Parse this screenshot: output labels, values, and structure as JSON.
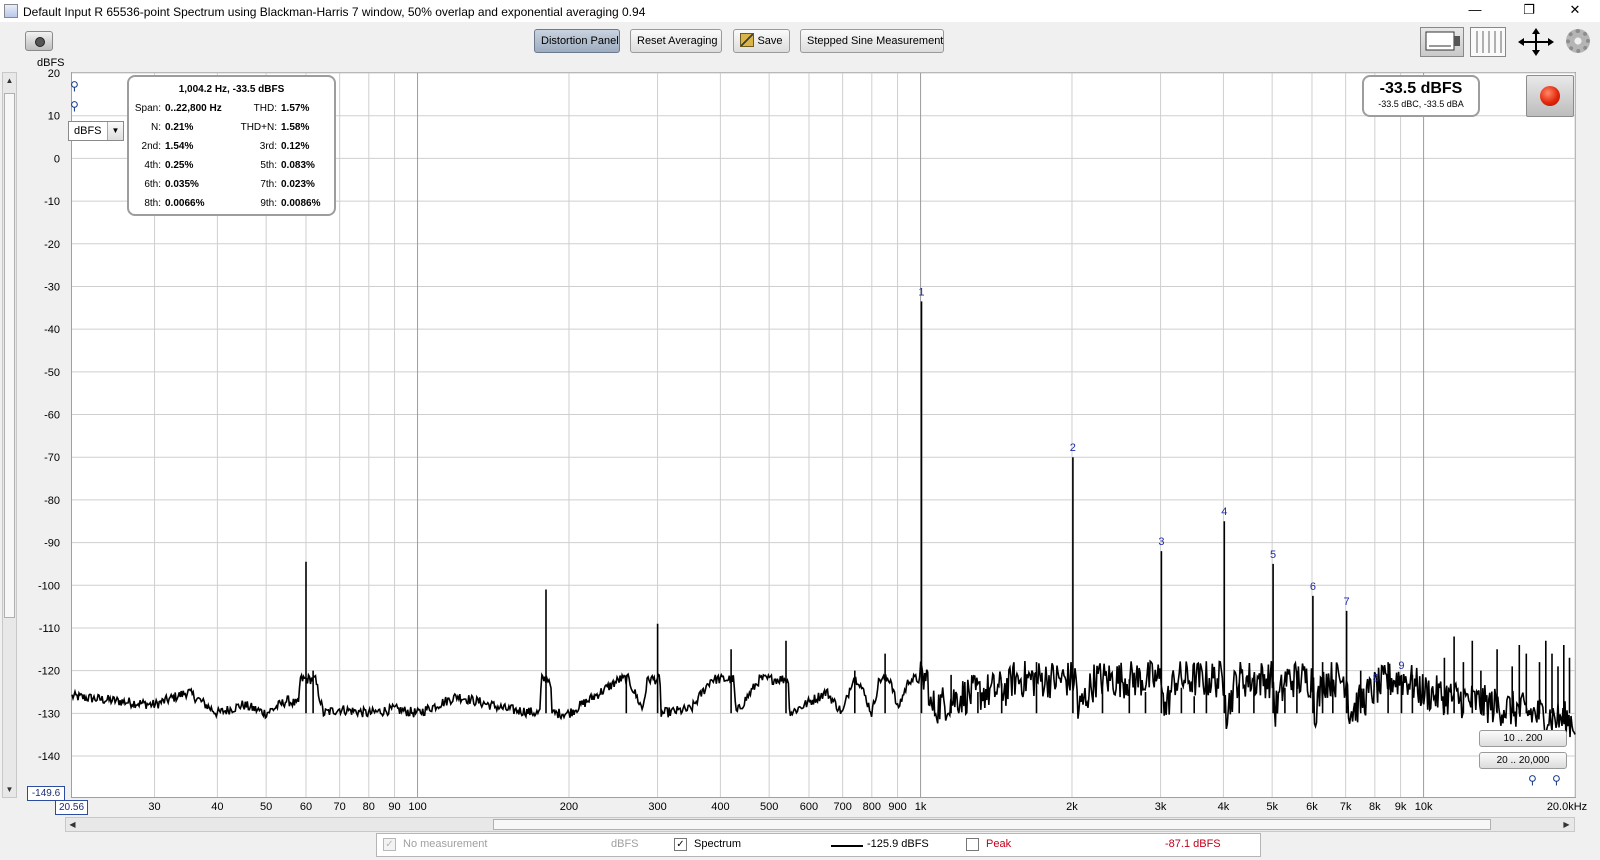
{
  "window": {
    "title": "Default Input R 65536-point Spectrum using Blackman-Harris 7 window, 50% overlap and exponential averaging 0.94",
    "minimize": "—",
    "restore": "❐",
    "close": "✕"
  },
  "toolbar": {
    "distortion_panel": "Distortion Panel",
    "reset_averaging": "Reset Averaging",
    "save": "Save",
    "stepped_sine": "Stepped Sine Measurement"
  },
  "icons": [
    "camera-icon",
    "graph-view-icon",
    "bars-view-icon",
    "pan-arrows-icon",
    "gear-icon",
    "record-icon",
    "zoom-icon",
    "save-icon"
  ],
  "plot": {
    "y_unit": "dBFS",
    "y_unit_select": "dBFS",
    "y_min_box": "-149.6",
    "x_min_box": "20.56",
    "range_buttons": [
      "10 .. 200",
      "20 .. 20,000"
    ]
  },
  "distortion": {
    "header": "1,004.2 Hz, -33.5 dBFS",
    "rows": [
      [
        {
          "label": "Span:",
          "value": "0..22,800 Hz"
        },
        {
          "label": "THD:",
          "value": "1.57%"
        }
      ],
      [
        {
          "label": "N:",
          "value": "0.21%"
        },
        {
          "label": "THD+N:",
          "value": "1.58%"
        }
      ],
      [
        {
          "label": "2nd:",
          "value": "1.54%"
        },
        {
          "label": "3rd:",
          "value": "0.12%"
        }
      ],
      [
        {
          "label": "4th:",
          "value": "0.25%"
        },
        {
          "label": "5th:",
          "value": "0.083%"
        }
      ],
      [
        {
          "label": "6th:",
          "value": "0.035%"
        },
        {
          "label": "7th:",
          "value": "0.023%"
        }
      ],
      [
        {
          "label": "8th:",
          "value": "0.0066%"
        },
        {
          "label": "9th:",
          "value": "0.0086%"
        }
      ]
    ]
  },
  "level": {
    "main": "-33.5 dBFS",
    "sub": "-33.5 dBC, -33.5 dBA"
  },
  "legend": {
    "no_measurement": "No measurement",
    "no_measurement_unit": "dBFS",
    "spectrum": "Spectrum",
    "spectrum_value": "-125.9 dBFS",
    "peak": "Peak",
    "peak_value": "-87.1 dBFS",
    "spectrum_checked": true,
    "peak_checked": false,
    "colors": {
      "spectrum": "#000000",
      "peak": "#c0001a"
    }
  },
  "chart_data": {
    "type": "line",
    "x_scale": "log",
    "y_unit": "dBFS",
    "x_unit": "Hz",
    "xlim": [
      20.56,
      20000
    ],
    "ylim": [
      -149.6,
      20
    ],
    "yticks": [
      20,
      10,
      0,
      -10,
      -20,
      -30,
      -40,
      -50,
      -60,
      -70,
      -80,
      -90,
      -100,
      -110,
      -120,
      -130,
      -140
    ],
    "xticks": [
      {
        "value": 30,
        "label": "30"
      },
      {
        "value": 40,
        "label": "40"
      },
      {
        "value": 50,
        "label": "50"
      },
      {
        "value": 60,
        "label": "60"
      },
      {
        "value": 70,
        "label": "70"
      },
      {
        "value": 80,
        "label": "80"
      },
      {
        "value": 90,
        "label": "90"
      },
      {
        "value": 100,
        "label": "100"
      },
      {
        "value": 200,
        "label": "200"
      },
      {
        "value": 300,
        "label": "300"
      },
      {
        "value": 400,
        "label": "400"
      },
      {
        "value": 500,
        "label": "500"
      },
      {
        "value": 600,
        "label": "600"
      },
      {
        "value": 700,
        "label": "700"
      },
      {
        "value": 800,
        "label": "800"
      },
      {
        "value": 900,
        "label": "900"
      },
      {
        "value": 1000,
        "label": "1k"
      },
      {
        "value": 2000,
        "label": "2k"
      },
      {
        "value": 3000,
        "label": "3k"
      },
      {
        "value": 4000,
        "label": "4k"
      },
      {
        "value": 5000,
        "label": "5k"
      },
      {
        "value": 6000,
        "label": "6k"
      },
      {
        "value": 7000,
        "label": "7k"
      },
      {
        "value": 8000,
        "label": "8k"
      },
      {
        "value": 9000,
        "label": "9k"
      },
      {
        "value": 10000,
        "label": "10k"
      },
      {
        "value": 20000,
        "label": "20.0kHz"
      }
    ],
    "grid": true,
    "series": [
      {
        "name": "Spectrum",
        "color": "#000000",
        "noise_floor": -130,
        "points": [
          [
            20.56,
            -126
          ],
          [
            30,
            -128
          ],
          [
            35,
            -125
          ],
          [
            40,
            -130
          ],
          [
            45,
            -128
          ],
          [
            50,
            -130
          ],
          [
            55,
            -127
          ],
          [
            58,
            -128
          ],
          [
            60,
            -94.5
          ],
          [
            62,
            -120
          ],
          [
            65,
            -130
          ],
          [
            70,
            -129
          ],
          [
            80,
            -130
          ],
          [
            90,
            -129
          ],
          [
            100,
            -130
          ],
          [
            120,
            -126
          ],
          [
            150,
            -129
          ],
          [
            175,
            -130
          ],
          [
            180,
            -101
          ],
          [
            185,
            -130
          ],
          [
            200,
            -130
          ],
          [
            260,
            -121
          ],
          [
            280,
            -129
          ],
          [
            300,
            -109
          ],
          [
            305,
            -130
          ],
          [
            350,
            -129
          ],
          [
            420,
            -115
          ],
          [
            430,
            -130
          ],
          [
            540,
            -113
          ],
          [
            550,
            -130
          ],
          [
            650,
            -125
          ],
          [
            700,
            -130
          ],
          [
            740,
            -120
          ],
          [
            800,
            -130
          ],
          [
            850,
            -116
          ],
          [
            900,
            -129
          ],
          [
            950,
            -122
          ],
          [
            1004.2,
            -33.5
          ],
          [
            1040,
            -129
          ],
          [
            1200,
            -126
          ],
          [
            1500,
            -124
          ],
          [
            2008,
            -70
          ],
          [
            2050,
            -130
          ],
          [
            3012,
            -92
          ],
          [
            3050,
            -130
          ],
          [
            4017,
            -85
          ],
          [
            4050,
            -130
          ],
          [
            5021,
            -95
          ],
          [
            5050,
            -130
          ],
          [
            6025,
            -102.5
          ],
          [
            6050,
            -130
          ],
          [
            7029,
            -106
          ],
          [
            7100,
            -130
          ],
          [
            8034,
            -124
          ],
          [
            9038,
            -121
          ],
          [
            10000,
            -125
          ],
          [
            20000,
            -132
          ]
        ],
        "spurs": [
          [
            1150,
            -121
          ],
          [
            1300,
            -125
          ],
          [
            1450,
            -123
          ],
          [
            1700,
            -118
          ],
          [
            2300,
            -124
          ],
          [
            2600,
            -122
          ],
          [
            2800,
            -125
          ],
          [
            3300,
            -124
          ],
          [
            3500,
            -126
          ],
          [
            3700,
            -121
          ],
          [
            4300,
            -123
          ],
          [
            4600,
            -122
          ],
          [
            5300,
            -124
          ],
          [
            5600,
            -120
          ],
          [
            6300,
            -118
          ],
          [
            6600,
            -122
          ],
          [
            7500,
            -120
          ],
          [
            8500,
            -118
          ],
          [
            9500,
            -121
          ],
          [
            11000,
            -117
          ],
          [
            11500,
            -112
          ],
          [
            12000,
            -118
          ],
          [
            12500,
            -113
          ],
          [
            13000,
            -120
          ],
          [
            14000,
            -115
          ],
          [
            15000,
            -119
          ],
          [
            15500,
            -114
          ],
          [
            16000,
            -116
          ],
          [
            17000,
            -118
          ],
          [
            17500,
            -113
          ],
          [
            18000,
            -116
          ],
          [
            18500,
            -119
          ],
          [
            19000,
            -114
          ],
          [
            19500,
            -117
          ]
        ]
      }
    ],
    "annotations": [
      {
        "label": "1",
        "x": 1004.2,
        "y": -33.5
      },
      {
        "label": "2",
        "x": 2008,
        "y": -70
      },
      {
        "label": "3",
        "x": 3012,
        "y": -92
      },
      {
        "label": "4",
        "x": 4017,
        "y": -85
      },
      {
        "label": "5",
        "x": 5021,
        "y": -95
      },
      {
        "label": "6",
        "x": 6025,
        "y": -102.5
      },
      {
        "label": "7",
        "x": 7029,
        "y": -106
      },
      {
        "label": "8",
        "x": 8034,
        "y": -124
      },
      {
        "label": "9",
        "x": 9038,
        "y": -121
      }
    ]
  }
}
